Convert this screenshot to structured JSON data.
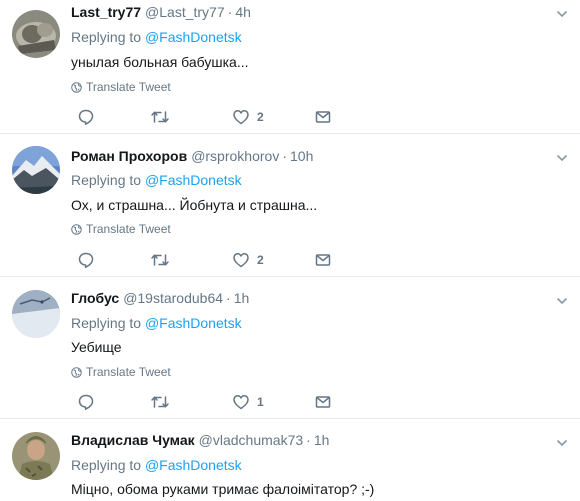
{
  "tweets": [
    {
      "name": "Last_try77",
      "handle": "@Last_try77",
      "time": "4h",
      "replying_prefix": "Replying to",
      "replying_to": "@FashDonetsk",
      "text": "унылая больная бабушка...",
      "translate": "Translate Tweet",
      "likes": "2"
    },
    {
      "name": "Роман Прохоров",
      "handle": "@rsprokhorov",
      "time": "10h",
      "replying_prefix": "Replying to",
      "replying_to": "@FashDonetsk",
      "text": "Ох, и страшна... Йобнута и страшна...",
      "translate": "Translate Tweet",
      "likes": "2"
    },
    {
      "name": "Глобус",
      "handle": "@19starodub64",
      "time": "1h",
      "replying_prefix": "Replying to",
      "replying_to": "@FashDonetsk",
      "text": "Уебище",
      "translate": "Translate Tweet",
      "likes": "1"
    },
    {
      "name": "Владислав Чумак",
      "handle": "@vladchumak73",
      "time": "1h",
      "replying_prefix": "Replying to",
      "replying_to": "@FashDonetsk",
      "text": "Міцно, обома руками тримає фалоімітатор? ;-)"
    }
  ],
  "separator": "·",
  "colors": {
    "link": "#1da1f2",
    "muted": "#657786",
    "text": "#14171a",
    "divider": "#e6ecf0"
  },
  "icons": [
    "globe-icon",
    "reply-icon",
    "retweet-icon",
    "like-icon",
    "dm-icon",
    "caret-down-icon"
  ]
}
